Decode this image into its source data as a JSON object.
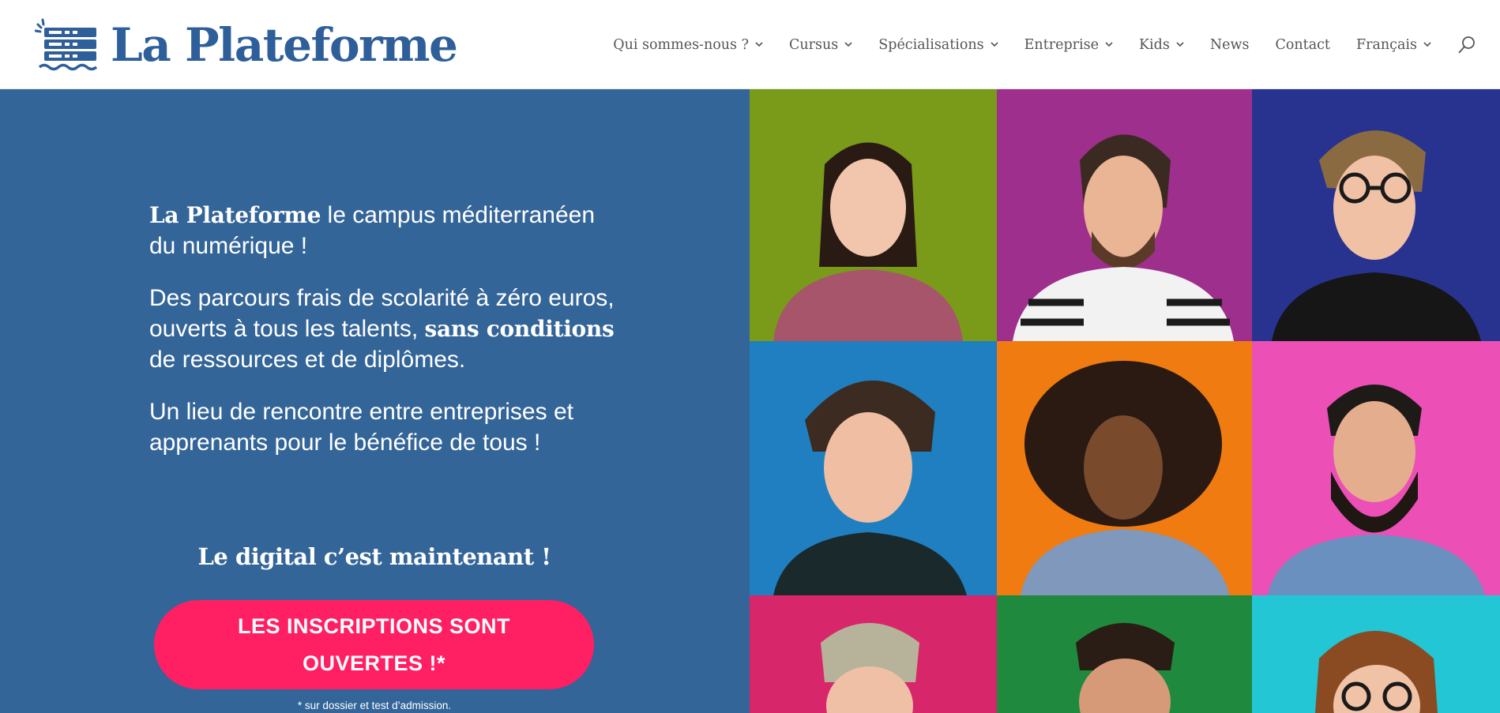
{
  "brand": {
    "name": "La Plateforme",
    "colors": {
      "primary": "#2f5f9b",
      "hero_bg": "#346598",
      "cta": "#ff1f63",
      "nav_text": "#555555"
    }
  },
  "nav": {
    "items": [
      {
        "label": "Qui sommes-nous ?",
        "dropdown": true
      },
      {
        "label": "Cursus",
        "dropdown": true
      },
      {
        "label": "Spécialisations",
        "dropdown": true
      },
      {
        "label": "Entreprise",
        "dropdown": true
      },
      {
        "label": "Kids",
        "dropdown": true
      },
      {
        "label": "News",
        "dropdown": false
      },
      {
        "label": "Contact",
        "dropdown": false
      },
      {
        "label": "Français",
        "dropdown": true
      }
    ],
    "search_icon": "search-icon"
  },
  "hero": {
    "p1": {
      "bold": "La Plateforme",
      "rest": " le campus méditerranéen du numérique !"
    },
    "p2": {
      "before": "Des parcours frais de scolarité à zéro euros, ouverts à tous les talents, ",
      "bold": "sans conditions",
      "after": " de ressources et de diplômes."
    },
    "p3": "Un lieu de rencontre entre entreprises et apprenants pour le bénéfice de tous !",
    "tagline": "Le digital c’est maintenant !",
    "cta_label": "LES INSCRIPTIONS SONT OUVERTES !*",
    "footnote": "* sur dossier et test d’admission."
  },
  "photo_grid": {
    "tile_colors": [
      "#7a9a1a",
      "#9e2f8c",
      "#28338f",
      "#1f7fc0",
      "#f07b10",
      "#ec4fb6",
      "#d8266a",
      "#1f8a3e",
      "#22c6d4"
    ]
  }
}
